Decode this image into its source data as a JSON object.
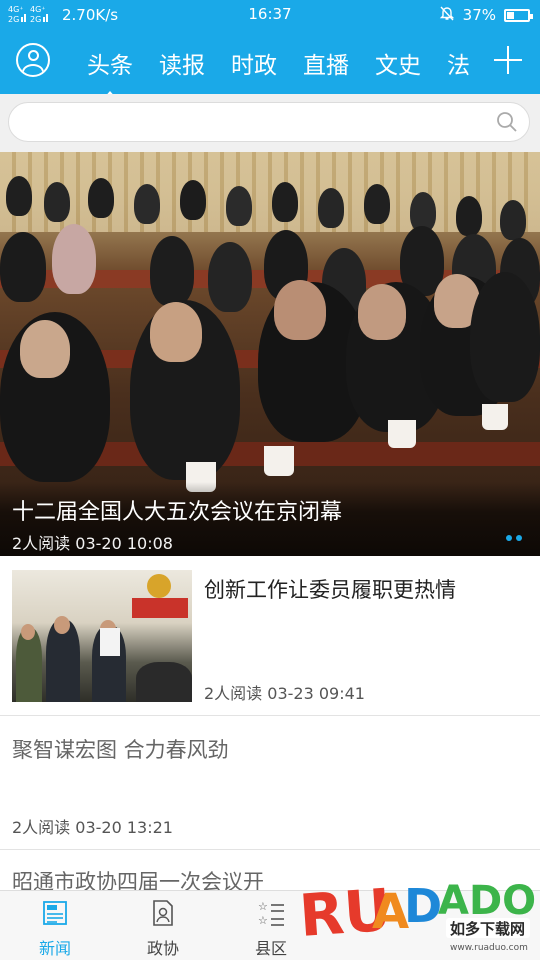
{
  "status_bar": {
    "network": "4G⁺ 4G⁺\n2G.ıl 2G.ıl",
    "speed": "2.70K/s",
    "time": "16:37",
    "battery": "37%",
    "battery_level": 0.37
  },
  "top_nav": {
    "tabs": [
      {
        "label": "头条",
        "active": true
      },
      {
        "label": "读报"
      },
      {
        "label": "时政"
      },
      {
        "label": "直播"
      },
      {
        "label": "文史"
      },
      {
        "label": "法"
      }
    ]
  },
  "search": {
    "placeholder": "",
    "value": ""
  },
  "banner": {
    "title": "十二届全国人大五次会议在京闭幕",
    "meta": "2人阅读  03-20 10:08",
    "slides": 2,
    "active_slide": 1
  },
  "news": [
    {
      "title": "创新工作让委员履职更热情",
      "meta": "2人阅读  03-23 09:41",
      "has_image": true
    },
    {
      "title": "聚智谋宏图 合力春风劲",
      "meta": "2人阅读  03-20 13:21",
      "has_image": false
    },
    {
      "title": "昭通市政协四届一次会议开",
      "meta": "",
      "has_image": false
    }
  ],
  "bottom_nav": [
    {
      "label": "新闻",
      "icon": "newspaper-icon",
      "active": true
    },
    {
      "label": "政协",
      "icon": "document-person-icon"
    },
    {
      "label": "县区",
      "icon": "star-list-icon"
    }
  ],
  "watermark": {
    "brand": "RUANDADO",
    "name": "如多下载网",
    "url": "www.ruaduo.com"
  },
  "colors": {
    "accent": "#1aa9e8",
    "text": "#222222",
    "muted": "#666666"
  }
}
